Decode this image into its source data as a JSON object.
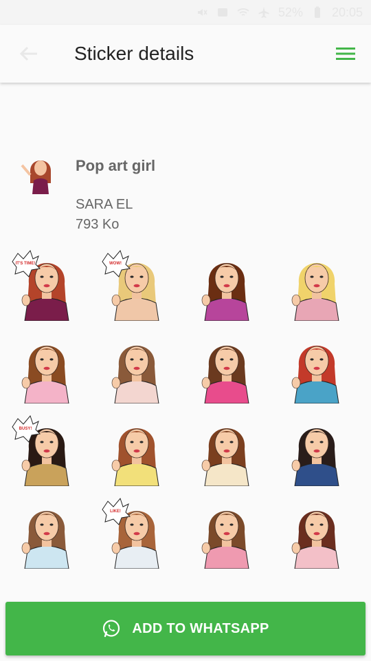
{
  "status_bar": {
    "battery": "52%",
    "time": "20:05",
    "icons": [
      "mute-icon",
      "screenshot-icon",
      "wifi-icon",
      "airplane-icon",
      "battery-icon"
    ]
  },
  "app_bar": {
    "title": "Sticker details",
    "back_icon": "arrow-left-icon",
    "menu_icon": "hamburger-menu-icon",
    "accent": "#43b649"
  },
  "pack": {
    "name": "Pop art girl",
    "publisher": "SARA EL",
    "size": "793 Ko"
  },
  "stickers": [
    {
      "hair": "#b4442a",
      "top": "#7a1d4a",
      "bg": "#ffffff",
      "bubble": "IT'S TIME!"
    },
    {
      "hair": "#e9c97a",
      "top": "#f0c7a8",
      "bg": "#ffffff",
      "bubble": "WOW!"
    },
    {
      "hair": "#6b2e12",
      "top": "#b7459b",
      "bg": "#ffffff",
      "bubble": ""
    },
    {
      "hair": "#f0d36b",
      "top": "#e8a6b5",
      "bg": "#ffffff",
      "bubble": ""
    },
    {
      "hair": "#8a4b22",
      "top": "#f4b3c8",
      "bg": "#ffffff",
      "bubble": ""
    },
    {
      "hair": "#8a5a3a",
      "top": "#f3d6d0",
      "bg": "#ffffff",
      "bubble": ""
    },
    {
      "hair": "#6b3a1f",
      "top": "#e84c8c",
      "bg": "#ffffff",
      "bubble": ""
    },
    {
      "hair": "#c33a2a",
      "top": "#4aa3c7",
      "bg": "#ffffff",
      "bubble": ""
    },
    {
      "hair": "#2a1a14",
      "top": "#c9a25b",
      "bg": "#ffffff",
      "bubble": "BUSY!"
    },
    {
      "hair": "#a0522d",
      "top": "#f2e07a",
      "bg": "#ffffff",
      "bubble": ""
    },
    {
      "hair": "#7b3f1f",
      "top": "#f5e6c8",
      "bg": "#ffffff",
      "bubble": ""
    },
    {
      "hair": "#2a1d1a",
      "top": "#2f4f8a",
      "bg": "#ffffff",
      "bubble": ""
    },
    {
      "hair": "#8a5a3a",
      "top": "#cde6f1",
      "bg": "#ffffff",
      "bubble": ""
    },
    {
      "hair": "#a8643a",
      "top": "#e8eef3",
      "bg": "#ffffff",
      "bubble": "LIKE!"
    },
    {
      "hair": "#7b4a2a",
      "top": "#ef9ab0",
      "bg": "#ffffff",
      "bubble": ""
    },
    {
      "hair": "#6b2e1f",
      "top": "#f3c0c8",
      "bg": "#ffffff",
      "bubble": ""
    }
  ],
  "add_button": {
    "label": "ADD TO WHATSAPP",
    "icon": "whatsapp-icon"
  }
}
